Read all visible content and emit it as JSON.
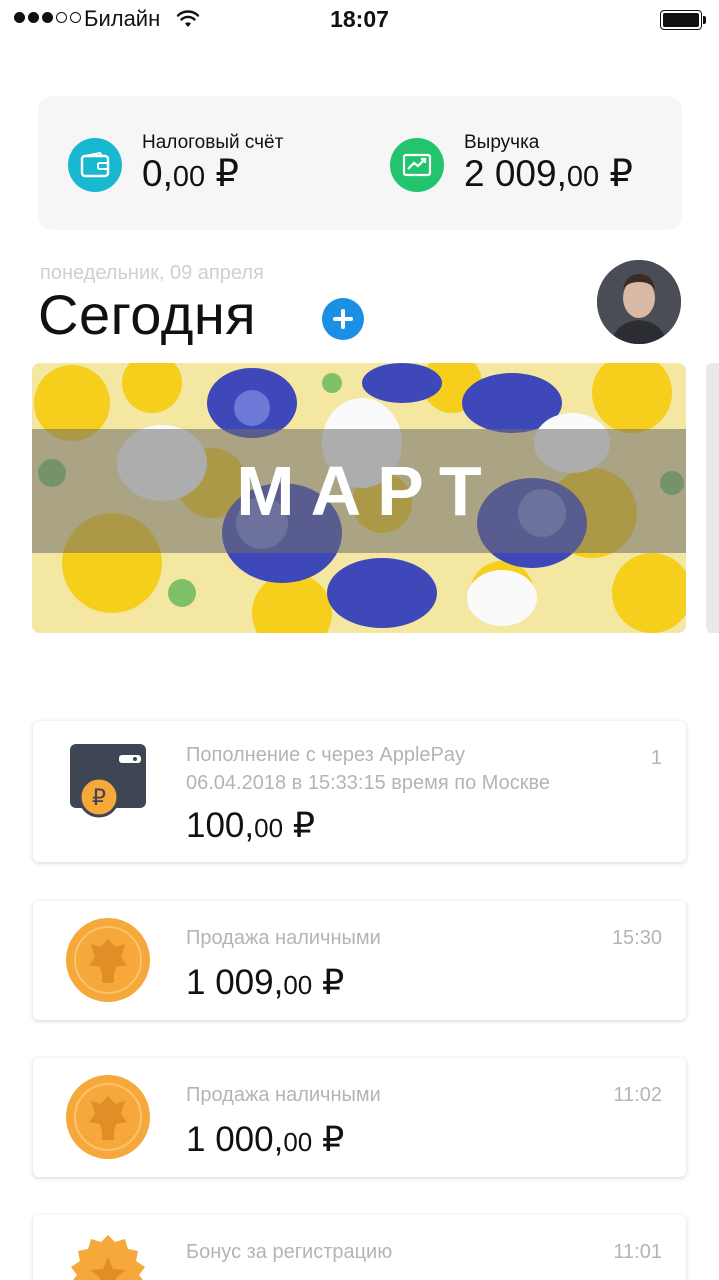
{
  "status_bar": {
    "carrier": "Билайн",
    "time": "18:07",
    "signal_bars_filled": 3,
    "signal_bars_total": 5
  },
  "balances": {
    "tax": {
      "label": "Налоговый счёт",
      "amount_main": "0,",
      "amount_cents": "00",
      "currency": " ₽",
      "icon": "wallet-icon",
      "color": "#17b8d0"
    },
    "revenue": {
      "label": "Выручка",
      "amount_main": "2 009,",
      "amount_cents": "00",
      "currency": " ₽",
      "icon": "chart-up-icon",
      "color": "#22c46e"
    }
  },
  "today": {
    "date": "понедельник, 09 апреля",
    "title": "Сегодня"
  },
  "banner": {
    "title": "МАРТ"
  },
  "transactions": [
    {
      "description_lines": [
        "Пополнение с через ApplePay",
        "06.04.2018 в 15:33:15 время по Москве"
      ],
      "time": "1",
      "amount_main": "100,",
      "amount_cents": "00",
      "currency": " ₽",
      "icon": "wallet-ruble-icon"
    },
    {
      "description_lines": [
        "Продажа наличными"
      ],
      "time": "15:30",
      "amount_main": "1 009,",
      "amount_cents": "00",
      "currency": " ₽",
      "icon": "coin-icon"
    },
    {
      "description_lines": [
        "Продажа наличными"
      ],
      "time": "11:02",
      "amount_main": "1 000,",
      "amount_cents": "00",
      "currency": " ₽",
      "icon": "coin-icon"
    },
    {
      "description_lines": [
        "Бонус за регистрацию"
      ],
      "time": "11:01",
      "amount_main": "",
      "amount_cents": "",
      "currency": "",
      "icon": "star-badge-icon"
    }
  ],
  "colors": {
    "accent": "#1a8fe3",
    "coin": "#f6a83a"
  }
}
